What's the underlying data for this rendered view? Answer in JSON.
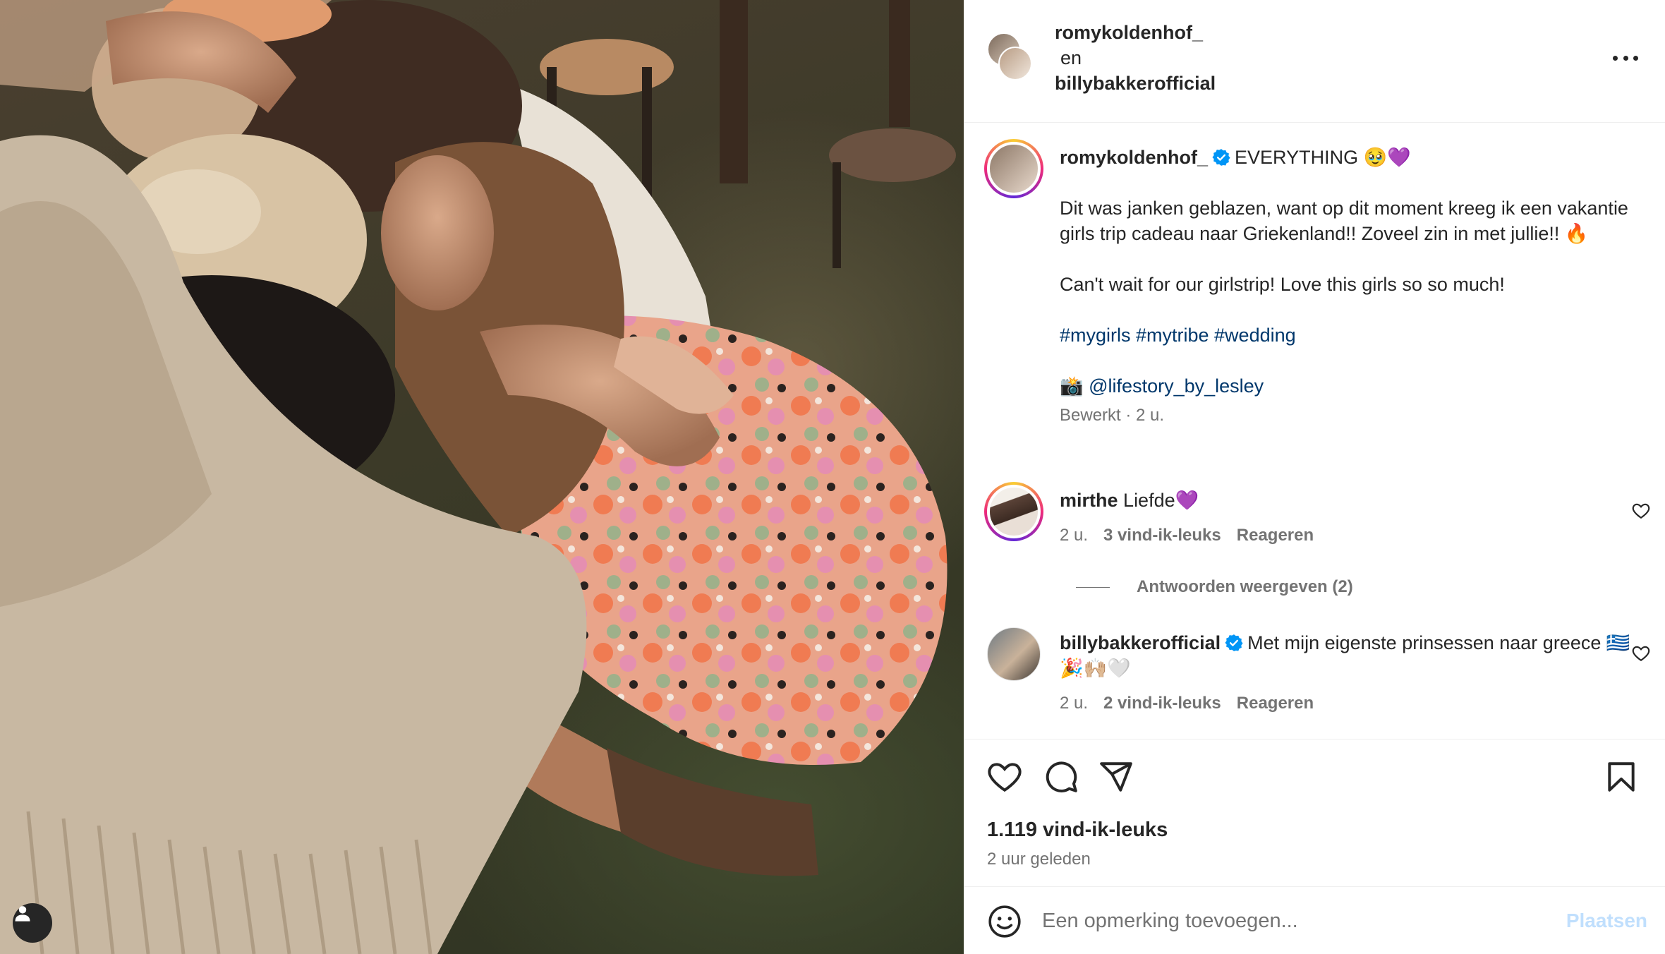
{
  "header": {
    "user1": "romykoldenhof_",
    "conjunction": "en",
    "user2": "billybakkerofficial",
    "more_icon": "more-horizontal-icon"
  },
  "caption": {
    "username": "romykoldenhof_",
    "first_line": "EVERYTHING 🥹💜",
    "paragraph1": "Dit was janken geblazen, want op dit moment kreeg ik een vakantie girls trip cadeau naar Griekenland!! Zoveel zin in met jullie!! 🔥",
    "paragraph2": "Can't wait for our girlstrip! Love this girls so so much!",
    "hashtags": "#mygirls #mytribe #wedding",
    "credit_emoji": "📸",
    "credit": "@lifestory_by_lesley",
    "meta": "Bewerkt · 2 u."
  },
  "comments": [
    {
      "username": "mirthe",
      "text": "Liefde💜",
      "time": "2 u.",
      "likes": "3 vind-ik-leuks",
      "reply": "Reageren",
      "view_replies": "Antwoorden weergeven (2)"
    },
    {
      "username": "billybakkerofficial",
      "text": "Met mijn eigenste prinsessen naar greece 🇬🇷🎉🙌🏼🤍",
      "time": "2 u.",
      "likes": "2 vind-ik-leuks",
      "reply": "Reageren"
    }
  ],
  "post": {
    "likes": "1.119 vind-ik-leuks",
    "time": "2 uur geleden"
  },
  "add_comment": {
    "placeholder": "Een opmerking toevoegen...",
    "post_label": "Plaatsen"
  },
  "colors": {
    "text": "#262626",
    "muted": "#737373",
    "link": "#00376b",
    "verified": "#0095f6",
    "post_disabled": "#c0dffd"
  }
}
